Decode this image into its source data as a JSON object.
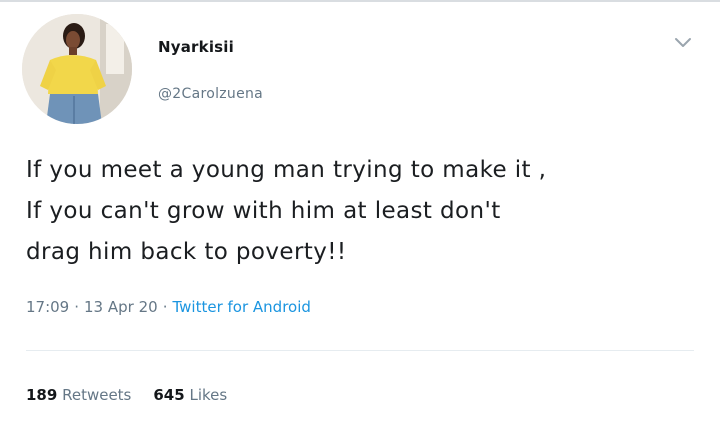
{
  "tweet": {
    "display_name": "Nyarkisii",
    "handle": "@2Carolzuena",
    "text_lines": [
      "If you meet a young man trying to make it ,",
      "If you can't grow with him at least don't",
      "drag him back to poverty!!"
    ],
    "time": "17:09",
    "date": "13 Apr 20",
    "separator": "·",
    "source": "Twitter for Android",
    "retweets_count": "189",
    "retweets_label": "Retweets",
    "likes_count": "645",
    "likes_label": "Likes"
  },
  "icons": {
    "menu": "chevron-down-icon",
    "avatar": "avatar"
  },
  "colors": {
    "link": "#1b95e0",
    "secondary_text": "#657786",
    "primary_text": "#14171a"
  }
}
